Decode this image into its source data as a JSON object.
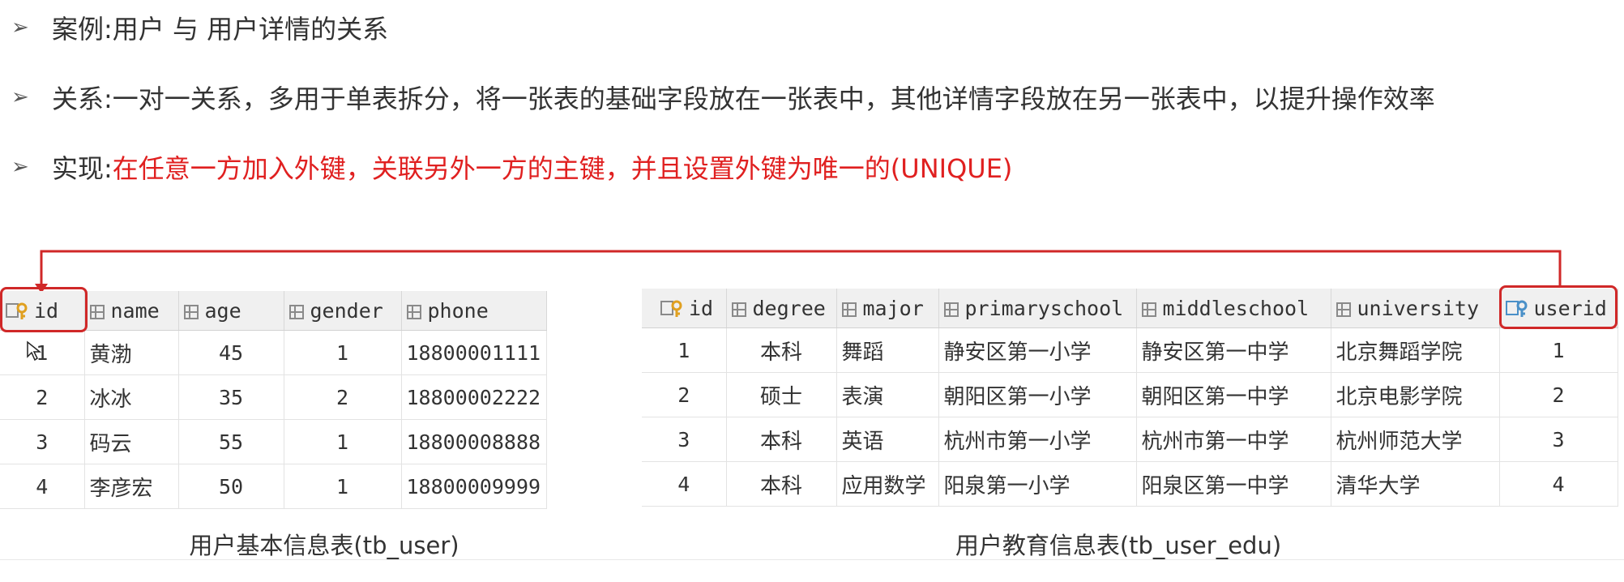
{
  "bullets": [
    {
      "prefix": "案例: ",
      "text": "用户 与 用户详情的关系",
      "highlight": ""
    },
    {
      "prefix": "关系: ",
      "text": "一对一关系，多用于单表拆分，将一张表的基础字段放在一张表中，其他详情字段放在另一张表中，以提升操作效率",
      "highlight": ""
    },
    {
      "prefix": "实现: ",
      "text": "",
      "highlight": "在任意一方加入外键，关联另外一方的主键，并且设置外键为唯一的(UNIQUE)"
    }
  ],
  "arrow_glyph": "➢",
  "colors": {
    "highlight": "#e02020",
    "relation_line": "#d02828",
    "key_icon": "#e0a020",
    "fk_icon": "#4a90c8"
  },
  "tb_user": {
    "caption": "用户基本信息表(tb_user)",
    "columns": [
      "id",
      "name",
      "age",
      "gender",
      "phone"
    ],
    "rows": [
      [
        "1",
        "黄渤",
        "45",
        "1",
        "18800001111"
      ],
      [
        "2",
        "冰冰",
        "35",
        "2",
        "18800002222"
      ],
      [
        "3",
        "码云",
        "55",
        "1",
        "18800008888"
      ],
      [
        "4",
        "李彦宏",
        "50",
        "1",
        "18800009999"
      ]
    ]
  },
  "tb_user_edu": {
    "caption": "用户教育信息表(tb_user_edu)",
    "columns": [
      "id",
      "degree",
      "major",
      "primaryschool",
      "middleschool",
      "university",
      "userid"
    ],
    "rows": [
      [
        "1",
        "本科",
        "舞蹈",
        "静安区第一小学",
        "静安区第一中学",
        "北京舞蹈学院",
        "1"
      ],
      [
        "2",
        "硕士",
        "表演",
        "朝阳区第一小学",
        "朝阳区第一中学",
        "北京电影学院",
        "2"
      ],
      [
        "3",
        "本科",
        "英语",
        "杭州市第一小学",
        "杭州市第一中学",
        "杭州师范大学",
        "3"
      ],
      [
        "4",
        "本科",
        "应用数学",
        "阳泉第一小学",
        "阳泉区第一中学",
        "清华大学",
        "4"
      ]
    ]
  },
  "icons": [
    "primary-key-icon",
    "column-icon",
    "foreign-key-icon",
    "mouse-cursor-icon"
  ]
}
